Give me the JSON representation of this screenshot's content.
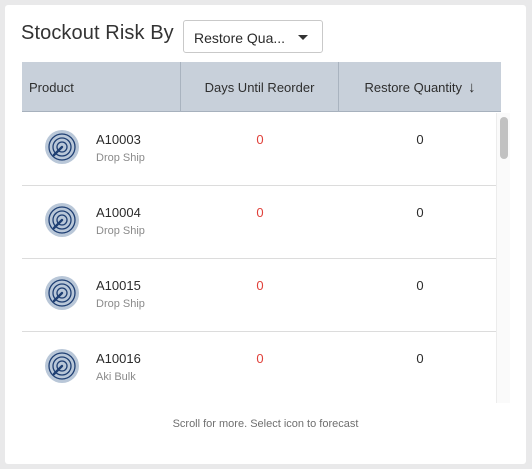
{
  "header": {
    "title": "Stockout Risk By",
    "dropdown_value": "Restore Qua..."
  },
  "table": {
    "columns": [
      "Product",
      "Days Until Reorder",
      "Restore Quantity"
    ],
    "sort_indicator": "↓",
    "rows": [
      {
        "sku": "A10003",
        "type": "Drop Ship",
        "days": "0",
        "qty": "0"
      },
      {
        "sku": "A10004",
        "type": "Drop Ship",
        "days": "0",
        "qty": "0"
      },
      {
        "sku": "A10015",
        "type": "Drop Ship",
        "days": "0",
        "qty": "0"
      },
      {
        "sku": "A10016",
        "type": "Aki Bulk",
        "days": "0",
        "qty": "0"
      }
    ]
  },
  "footer": {
    "hint": "Scroll for more. Select icon to forecast"
  },
  "colors": {
    "header_bg": "#c8d0da",
    "days_value": "#e0403a",
    "icon_fill": "#b9c7d8",
    "icon_stroke": "#1f3f73"
  },
  "icons": {
    "row_icon": "forecast-target-icon",
    "dropdown_caret": "caret-down-icon",
    "sort": "sort-descending-icon"
  }
}
